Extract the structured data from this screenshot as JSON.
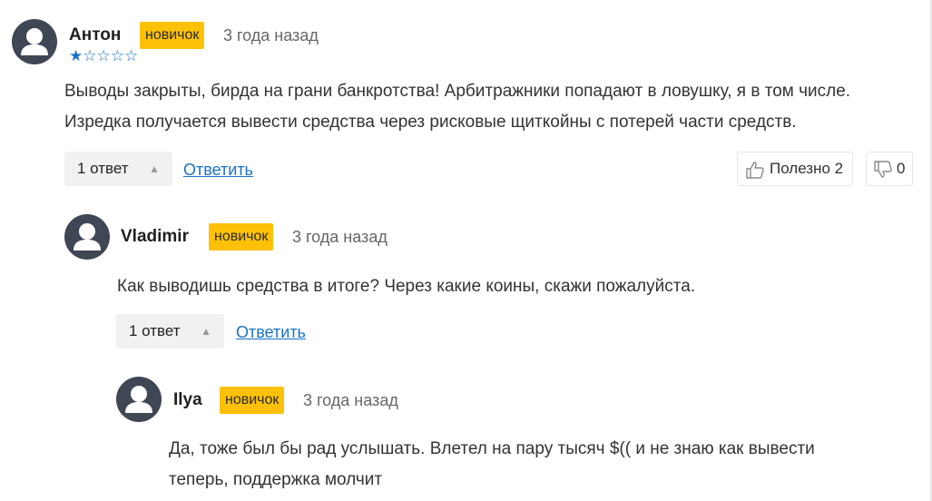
{
  "comments": [
    {
      "author": "Антон",
      "badge": "новичок",
      "date": "3 года назад",
      "rating_stars": 1,
      "rating_max": 5,
      "rating_display": "★☆☆☆☆",
      "lines": [
        "Выводы закрыты, бирда на грани банкротства! Арбитражники попадают в ловушку, я в том числе.",
        "Изредка получается вывести средства через рисковые щиткойны с потерей части средств."
      ],
      "replies_label": "1 ответ",
      "reply_link": "Ответить",
      "helpful_label": "Полезно",
      "helpful_count": "2",
      "unhelpful_count": "0"
    },
    {
      "author": "Vladimir",
      "badge": "новичок",
      "date": "3 года назад",
      "lines": [
        "Как выводишь средства в итоге? Через какие коины, скажи пожалуйста."
      ],
      "replies_label": "1 ответ",
      "reply_link": "Ответить"
    },
    {
      "author": "Ilya",
      "badge": "новичок",
      "date": "3 года назад",
      "lines": [
        "Да, тоже был бы рад услышать. Влетел на пару тысяч $(( и не знаю как вывести",
        "теперь, поддержка молчит"
      ]
    }
  ],
  "colors": {
    "badge": "#ffc107",
    "link": "#1a73c9",
    "avatar": "#3f4654"
  },
  "icons": {
    "avatar": "user-silhouette-icon",
    "expand": "chevron-up-icon",
    "like": "thumbs-up-icon",
    "dislike": "thumbs-down-icon"
  }
}
